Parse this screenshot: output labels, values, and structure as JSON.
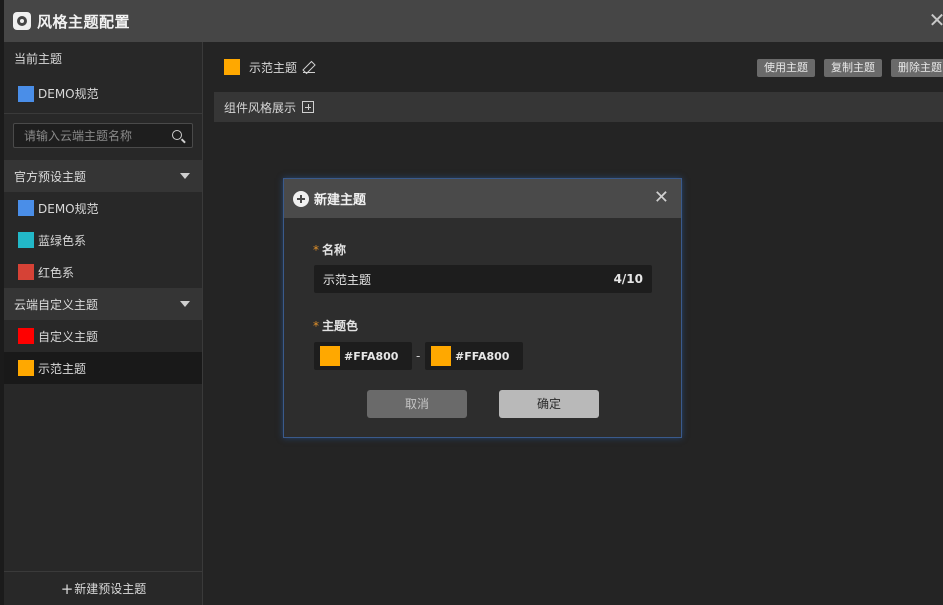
{
  "window": {
    "title": "风格主题配置",
    "close_icon": "close-icon"
  },
  "colors": {
    "demo_blue": "#4a8ee8",
    "teal": "#22b8c8",
    "red_series": "#d64236",
    "custom_red": "#ff0000",
    "demo_orange": "#ffa800"
  },
  "sidebar": {
    "current_label": "当前主题",
    "current_theme": {
      "name": "DEMO规范"
    },
    "search": {
      "placeholder": "请输入云端主题名称"
    },
    "official_group": {
      "label": "官方预设主题",
      "items": [
        {
          "name": "DEMO规范"
        },
        {
          "name": "蓝绿色系"
        },
        {
          "name": "红色系"
        }
      ]
    },
    "cloud_group": {
      "label": "云端自定义主题",
      "items": [
        {
          "name": "自定义主题"
        },
        {
          "name": "示范主题"
        }
      ]
    },
    "footer_label": "新建预设主题"
  },
  "main": {
    "theme_name": "示范主题",
    "actions": [
      "使用主题",
      "复制主题",
      "删除主题"
    ],
    "component_section": "组件风格展示"
  },
  "modal": {
    "title": "新建主题",
    "name_label": "名称",
    "name_value": "示范主题",
    "name_count": "4/10",
    "color_label": "主题色",
    "color_start": "#FFA800",
    "color_end": "#FFA800",
    "separator": "-",
    "cancel": "取消",
    "confirm": "确定"
  }
}
